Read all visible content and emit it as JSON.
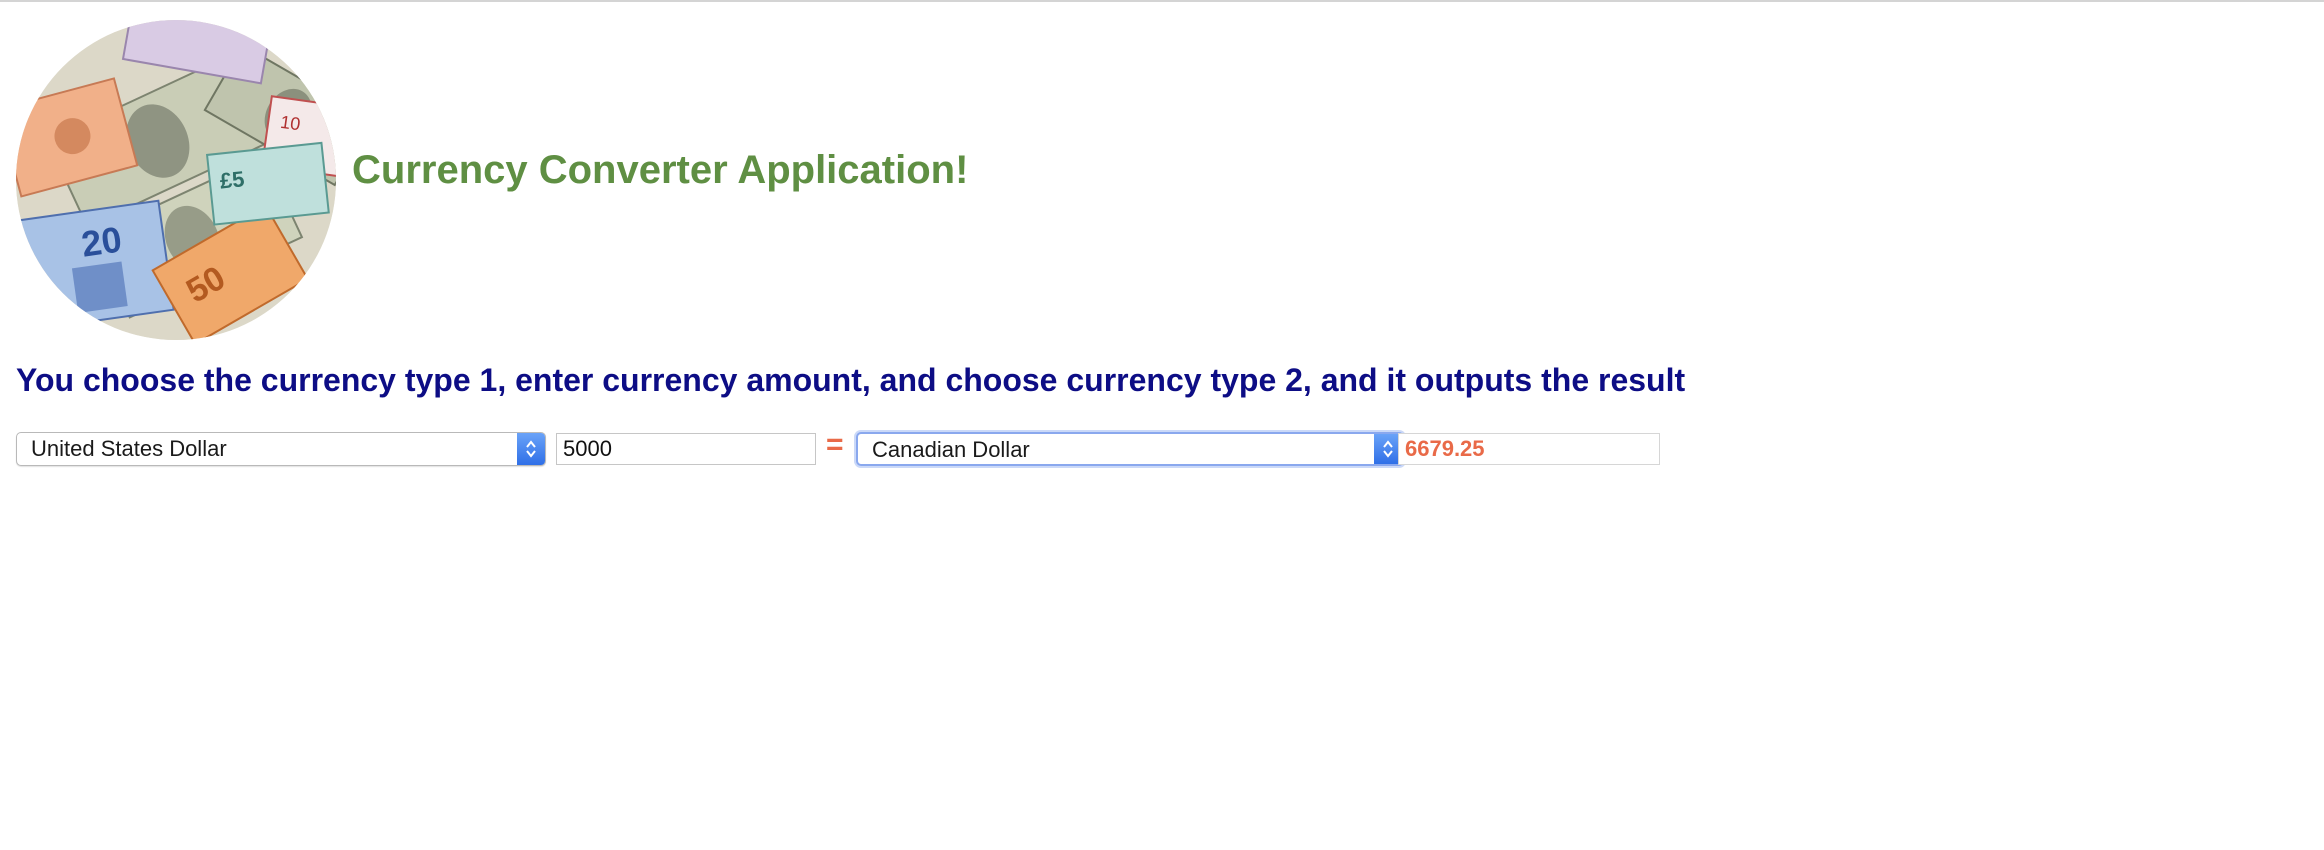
{
  "header": {
    "title": "Currency Converter Application!",
    "logo_icon": "currency-banknotes-logo"
  },
  "instructions": "You choose the currency type 1, enter currency amount, and choose currency type 2, and it outputs the result",
  "converter": {
    "from_currency": "United States Dollar",
    "amount": "5000",
    "equals_sign": "=",
    "to_currency": "Canadian Dollar",
    "result": "6679.25"
  },
  "colors": {
    "title": "#5f8f43",
    "instructions": "#0d0d85",
    "accent": "#e96a48",
    "select_arrow": "#2f6fe7"
  }
}
